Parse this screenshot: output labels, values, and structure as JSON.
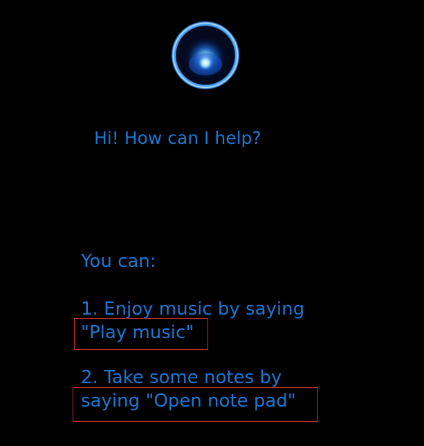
{
  "assistant": {
    "orb_icon": "voice-assistant-orb-icon",
    "greeting": "Hi! How can I help?",
    "accent_color": "#1a78d6",
    "highlight_color": "#c8322f"
  },
  "suggestions": {
    "heading": "You can:",
    "items": [
      {
        "line1": "1. Enjoy music by saying",
        "line2": "\"Play music\""
      },
      {
        "line1": "2. Take some notes by",
        "line2": "saying \"Open note pad\""
      }
    ]
  }
}
